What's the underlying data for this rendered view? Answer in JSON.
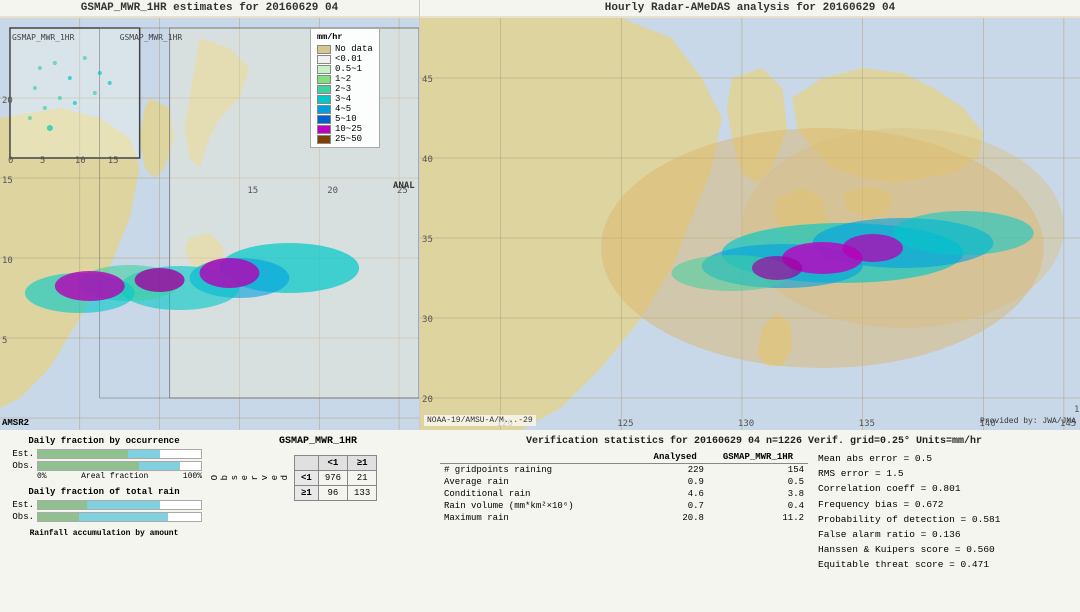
{
  "left_map": {
    "title": "GSMAP_MWR_1HR estimates for 20160629 04"
  },
  "right_map": {
    "title": "Hourly Radar-AMeDAS analysis for 20160629 04",
    "label_bottom_left": "NOAA-19/AMSU-A/M...-29",
    "label_bottom_right": "Provided by: JWA/JMA"
  },
  "legend": {
    "title": "mm/hr",
    "items": [
      {
        "label": "No data",
        "color": "#d4c890"
      },
      {
        "label": "<0.01",
        "color": "#f5f5f5"
      },
      {
        "label": "0.5~1",
        "color": "#c8f0c8"
      },
      {
        "label": "1~2",
        "color": "#80e080"
      },
      {
        "label": "2~3",
        "color": "#40d0a0"
      },
      {
        "label": "3~4",
        "color": "#00c8c8"
      },
      {
        "label": "4~5",
        "color": "#00a0e0"
      },
      {
        "label": "5~10",
        "color": "#0060d0"
      },
      {
        "label": "10~25",
        "color": "#c000c0"
      },
      {
        "label": "25~50",
        "color": "#804000"
      }
    ]
  },
  "charts": {
    "title1": "Daily fraction by occurrence",
    "title2": "Daily fraction of total rain",
    "title3": "Rainfall accumulation by amount",
    "est_label": "Est.",
    "obs_label": "Obs.",
    "axis_left": "0%",
    "axis_right": "100%",
    "axis_label": "Areal fraction"
  },
  "contingency": {
    "title": "GSMAP_MWR_1HR",
    "col_header_lt1": "<1",
    "col_header_ge1": "≥1",
    "row_header_lt1": "<1",
    "row_header_ge1": "≥1",
    "obs_label": "O\nb\ns\ne\nr\nv\ne\nd",
    "cell_tl": "976",
    "cell_tr": "21",
    "cell_bl": "96",
    "cell_br": "133"
  },
  "verification": {
    "title": "Verification statistics for 20160629 04  n=1226  Verif. grid=0.25°  Units=mm/hr",
    "col_analysed": "Analysed",
    "col_gsmap": "GSMAP_MWR_1HR",
    "divider": "-----------------------------------------------",
    "rows": [
      {
        "label": "# gridpoints raining",
        "analysed": "229",
        "gsmap": "154"
      },
      {
        "label": "Average rain",
        "analysed": "0.9",
        "gsmap": "0.5"
      },
      {
        "label": "Conditional rain",
        "analysed": "4.6",
        "gsmap": "3.8"
      },
      {
        "label": "Rain volume (mm*km²×10⁶)",
        "analysed": "0.7",
        "gsmap": "0.4"
      },
      {
        "label": "Maximum rain",
        "analysed": "20.8",
        "gsmap": "11.2"
      }
    ],
    "stats": {
      "mean_abs_error": "Mean abs error = 0.5",
      "rms_error": "RMS error = 1.5",
      "correlation": "Correlation coeff = 0.801",
      "freq_bias": "Frequency bias = 0.672",
      "prob_detection": "Probability of detection = 0.581",
      "false_alarm": "False alarm ratio = 0.136",
      "hanssen": "Hanssen & Kuipers score = 0.560",
      "equitable": "Equitable threat score = 0.471"
    }
  },
  "map_inset_label": "GSMAP_MWR_1HR",
  "amsr2_label": "AMSR2"
}
